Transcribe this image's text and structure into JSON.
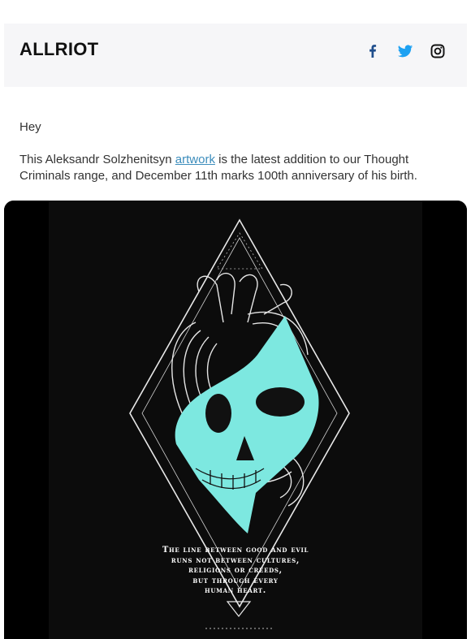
{
  "header": {
    "brand": "ALLRIOT",
    "social": [
      {
        "icon": "facebook-icon",
        "color": "#1f4e8c"
      },
      {
        "icon": "twitter-icon",
        "color": "#1da1f2"
      },
      {
        "icon": "instagram-icon",
        "color": "#111111"
      }
    ]
  },
  "body": {
    "greeting": "Hey",
    "intro_before": "This Aleksandr Solzhenitsyn ",
    "intro_link": "artwork",
    "intro_after": " is the latest addition to our Thought Criminals range, and December 11th marks 100th anniversary of his birth."
  },
  "hero": {
    "accent_color": "#7de8e0",
    "quote_lines": [
      "The line between good and evil",
      "runs not between cultures,",
      "religions or creeds,",
      "but through every",
      "human heart."
    ]
  }
}
